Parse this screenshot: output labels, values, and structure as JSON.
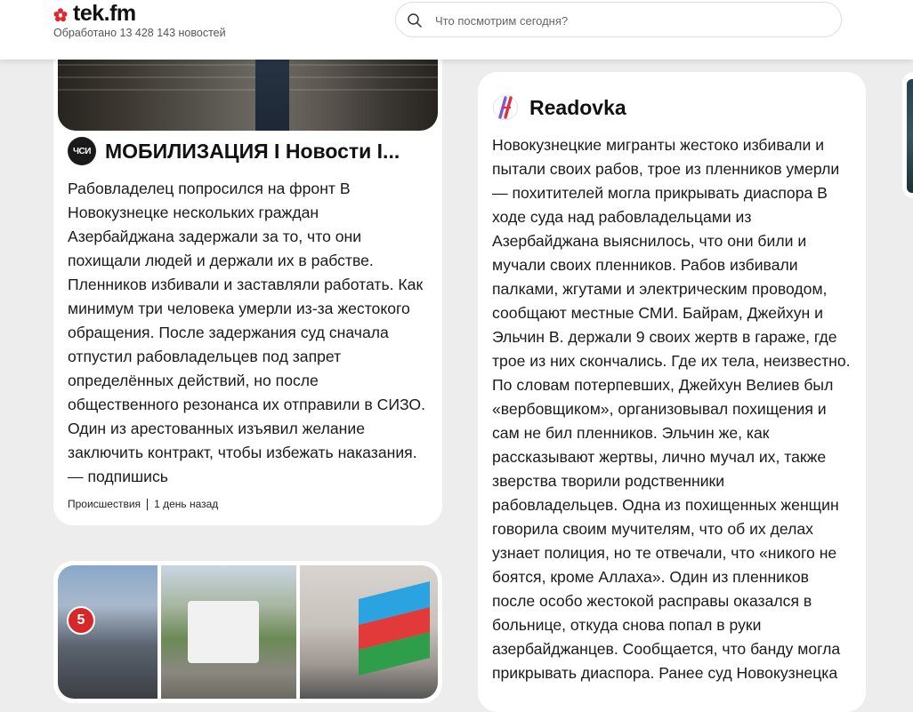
{
  "header": {
    "logo_text": "tek.fm",
    "processed_text": "Обработано 13 428 143 новостей",
    "search_placeholder": "Что посмотрим сегодня?"
  },
  "cards": [
    {
      "source": "МОБИЛИЗАЦИЯ I Новости I...",
      "lines": [
        "Рабовладелец попросился на фронт В",
        "Новокузнецке нескольких граждан",
        "Азербайджана задержали за то, что они",
        "похищали людей и держали их в рабстве.",
        "Пленников избивали и заставляли работать. Как",
        "минимум три человека умерли из-за жестокого",
        "обращения. После задержания суд сначала",
        "отпустил рабовладельцев под запрет",
        "определённых действий, но после",
        "общественного резонанса их отправили в СИЗО.",
        "Один из арестованных изъявил желание",
        "заключить контракт, чтобы избежать наказания.",
        "— подпишись"
      ],
      "category": "Происшествия",
      "time": "1 день назад"
    },
    {
      "source": "Readovka",
      "lines": [
        "Новокузнецкие мигранты жестоко избивали и",
        "пытали своих рабов, трое из пленников умерли",
        "— похитителей могла прикрывать диаспора В",
        "ходе суда над рабовладельцами из",
        "Азербайджана выяснилось, что они били и",
        "мучали своих пленников. Рабов избивали",
        "палками, жгутами и электрическим проводом,",
        "сообщают местные СМИ. Байрам, Джейхун и",
        "Эльчин В. держали 9 своих жертв в гараже, где",
        "трое из них скончались. Где их тела, неизвестно.",
        "По словам потерпевших, Джейхун Велиев был",
        "«вербовщиком», организовывал похищения и",
        "сам не бил пленников. Эльчин же, как",
        "рассказывают жертвы, лично мучал их, также",
        "зверства творили родственники",
        "рабовладельцев. Одна из похищенных женщин",
        "говорила своим мучителям, что об их делах",
        "узнает полиция, но те отвечали, что «никого не",
        "боятся, кроме Аллаха». Один из пленников",
        "после особо жестокой расправы оказался в",
        "больнице, откуда снова попал в руки",
        "азербайджанцев. Сообщается, что банду могла",
        "прикрывать диаспора. Ранее суд Новокузнецка"
      ]
    }
  ],
  "colors": {
    "background": "#ededed",
    "card": "#ffffff",
    "logo_red": "#e0282f",
    "text": "#1a1a1a"
  },
  "icons": {
    "logo": "red-flower-icon",
    "search": "search-icon",
    "readovka": "readovka-logo-icon"
  }
}
